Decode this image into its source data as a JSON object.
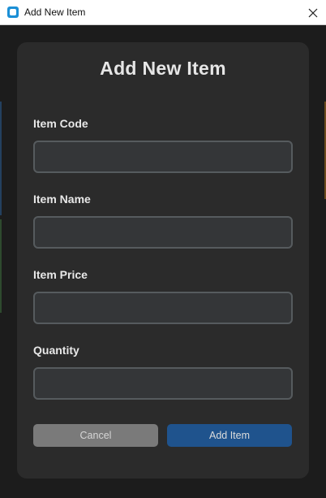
{
  "window": {
    "title": "Add New Item"
  },
  "form": {
    "heading": "Add New Item",
    "fields": [
      {
        "label": "Item Code",
        "value": ""
      },
      {
        "label": "Item Name",
        "value": ""
      },
      {
        "label": "Item Price",
        "value": ""
      },
      {
        "label": "Quantity",
        "value": ""
      }
    ],
    "cancel_label": "Cancel",
    "submit_label": "Add Item"
  },
  "colors": {
    "title_bar": "#ffffff",
    "card_background": "#2b2b2b",
    "input_background": "#343638",
    "input_border": "#565b5e",
    "cancel_button": "#7a7a7a",
    "submit_button": "#1f538d"
  },
  "icons": {
    "app": "app-icon",
    "close": "close-icon"
  }
}
